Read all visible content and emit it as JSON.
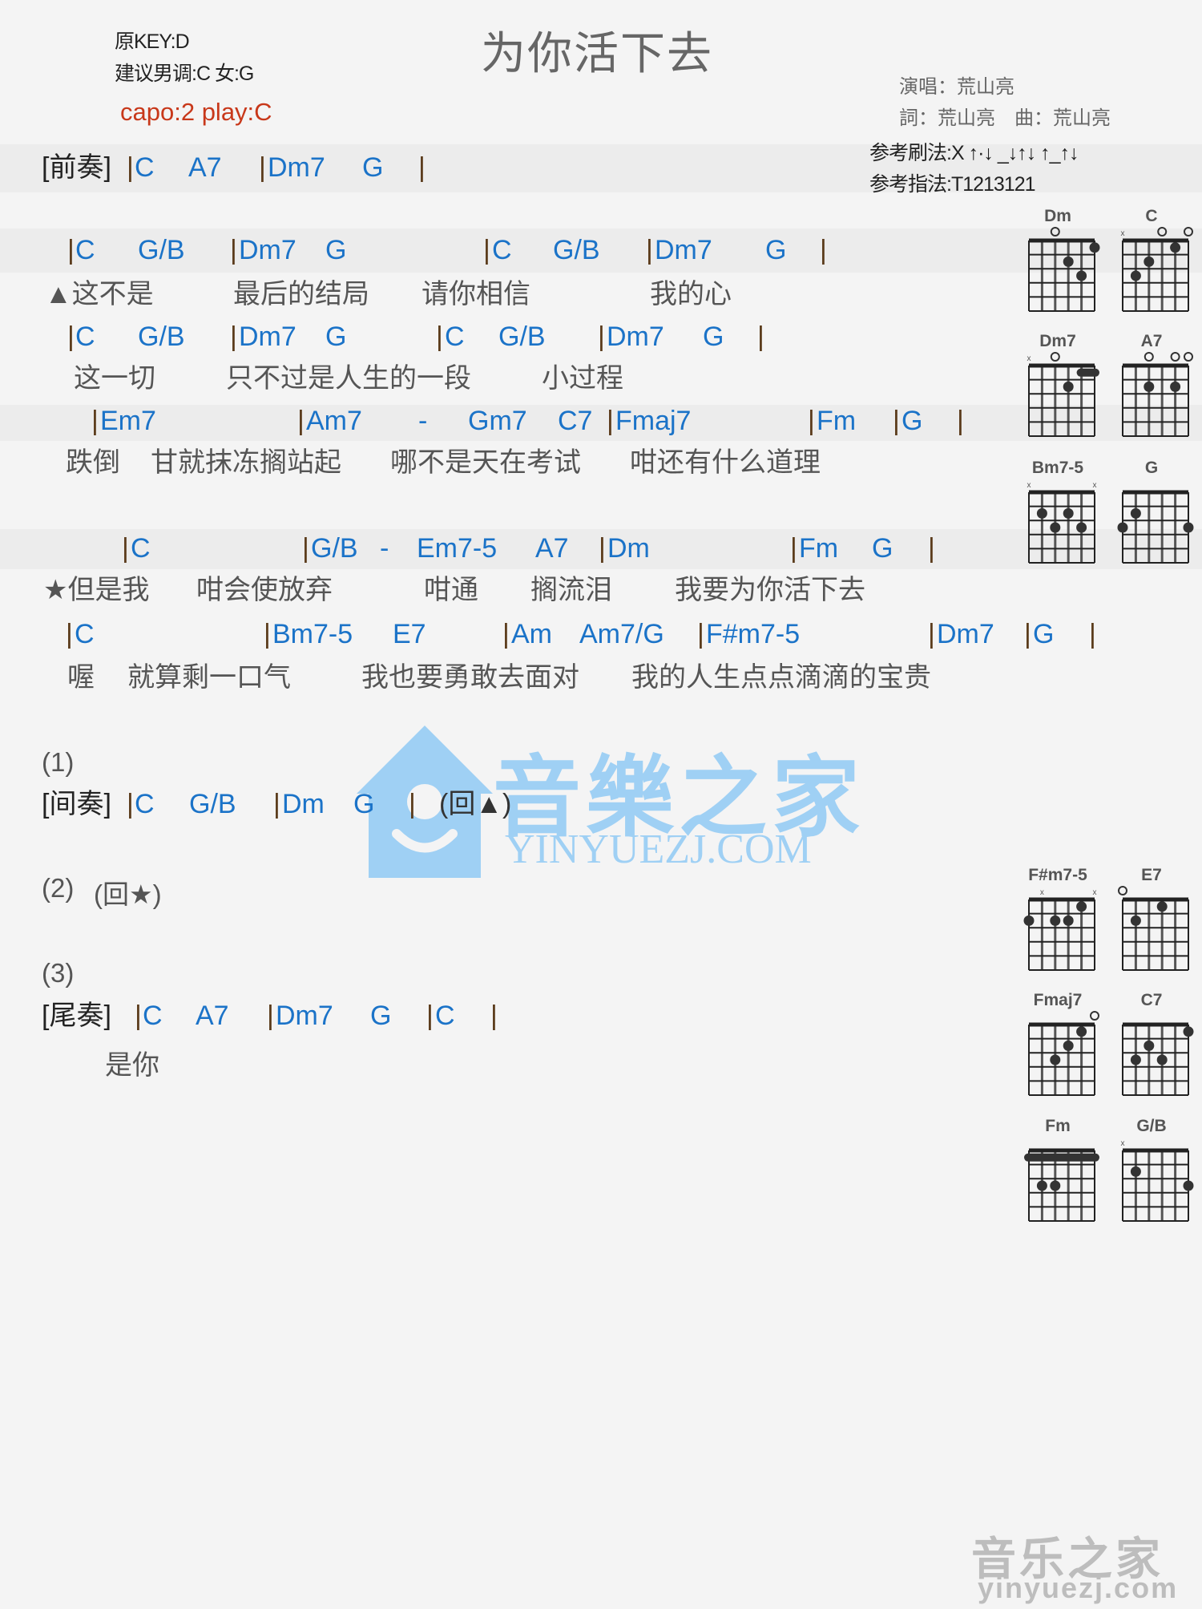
{
  "header": {
    "title": "为你活下去",
    "original_key": "原KEY:D",
    "suggested_key": "建议男调:C 女:G",
    "capo": "capo:2 play:C",
    "singer": "演唱：荒山亮",
    "writers": "詞：荒山亮　曲：荒山亮",
    "strum_pattern": "参考刷法:X ↑·↓ _↓↑↓ ↑_↑↓",
    "finger_pattern": "参考指法:T1213121"
  },
  "intro": {
    "label": "[前奏]",
    "tokens": [
      "|",
      "C",
      "A7",
      "|",
      "Dm7",
      "G",
      "|"
    ]
  },
  "verse": [
    {
      "chords": [
        "|",
        "C",
        "G/B",
        "|",
        "Dm7",
        "G",
        "|",
        "C",
        "G/B",
        "|",
        "Dm7",
        "G",
        "|"
      ],
      "lyrics": [
        "▲这不是",
        "最后的结局",
        "请你相信",
        "我的心"
      ]
    },
    {
      "chords": [
        "|",
        "C",
        "G/B",
        "|",
        "Dm7",
        "G",
        "|",
        "C",
        "G/B",
        "|",
        "Dm7",
        "G",
        "|"
      ],
      "lyrics": [
        "这一切",
        "只不过是人生的一段",
        "小过程"
      ]
    },
    {
      "chords": [
        "|",
        "Em7",
        "|",
        "Am7",
        "-",
        "Gm7",
        "C7",
        "|",
        "Fmaj7",
        "|",
        "Fm",
        "|",
        "G",
        "|"
      ],
      "lyrics": [
        "跌倒",
        "甘就抹冻搁站起",
        "哪不是天在考试",
        "咁还有什么道理"
      ]
    }
  ],
  "chorus": [
    {
      "chords": [
        "|",
        "C",
        "|",
        "G/B",
        "-",
        "Em7-5",
        "A7",
        "|",
        "Dm",
        "|",
        "Fm",
        "G",
        "|"
      ],
      "lyrics": [
        "★但是我",
        "咁会使放弃",
        "咁通",
        "搁流泪",
        "我要为你活下去"
      ]
    },
    {
      "chords": [
        "|",
        "C",
        "|",
        "Bm7-5",
        "E7",
        "|",
        "Am",
        "Am7/G",
        "|",
        "F#m7-5",
        "|",
        "Dm7",
        "|",
        "G",
        "|"
      ],
      "lyrics": [
        "喔",
        "就算剩一口气",
        "我也要勇敢去面对",
        "我的人生点点滴滴的宝贵"
      ]
    }
  ],
  "part1": {
    "marker": "(1)",
    "label": "[间奏]",
    "tokens": [
      "|",
      "C",
      "G/B",
      "|",
      "Dm",
      "G",
      "|"
    ],
    "repeat": "(回▲)"
  },
  "part2": {
    "marker": "(2)",
    "repeat": "(回★)"
  },
  "part3": {
    "marker": "(3)",
    "label": "[尾奏]",
    "tokens": [
      "|",
      "C",
      "A7",
      "|",
      "Dm7",
      "G",
      "|",
      "C",
      "|"
    ],
    "lyric": "是你"
  },
  "chord_diagrams": [
    {
      "name": "Dm",
      "open": [
        4
      ],
      "muted": [],
      "dots": [
        [
          1,
          1
        ],
        [
          3,
          2
        ],
        [
          2,
          3
        ]
      ],
      "barre": null
    },
    {
      "name": "C",
      "open": [
        3,
        1
      ],
      "muted": [
        6
      ],
      "dots": [
        [
          2,
          1
        ],
        [
          4,
          2
        ],
        [
          5,
          3
        ]
      ],
      "barre": null
    },
    {
      "name": "Dm7",
      "open": [
        4
      ],
      "muted": [
        6
      ],
      "dots": [
        [
          3,
          2
        ]
      ],
      "barre": {
        "fret": 1,
        "from": 2,
        "to": 1
      }
    },
    {
      "name": "A7",
      "open": [
        4,
        2,
        1
      ],
      "muted": [],
      "dots": [
        [
          4,
          2
        ],
        [
          2,
          2
        ]
      ],
      "barre": null
    },
    {
      "name": "Bm7-5",
      "open": [],
      "muted": [
        6,
        1
      ],
      "dots": [
        [
          5,
          2
        ],
        [
          3,
          2
        ],
        [
          4,
          3
        ],
        [
          2,
          3
        ]
      ],
      "barre": null
    },
    {
      "name": "G",
      "open": [],
      "muted": [],
      "dots": [
        [
          5,
          2
        ],
        [
          6,
          3
        ],
        [
          1,
          3
        ]
      ],
      "barre": null
    },
    {
      "name": "F#m7-5",
      "open": [],
      "muted": [
        5,
        1
      ],
      "dots": [
        [
          2,
          1
        ],
        [
          6,
          2
        ],
        [
          4,
          2
        ],
        [
          3,
          2
        ]
      ],
      "barre": null
    },
    {
      "name": "E7",
      "open": [
        6
      ],
      "muted": [],
      "dots": [
        [
          3,
          1
        ],
        [
          5,
          2
        ]
      ],
      "barre": null
    },
    {
      "name": "Fmaj7",
      "open": [
        1
      ],
      "muted": [],
      "dots": [
        [
          2,
          1
        ],
        [
          3,
          2
        ],
        [
          4,
          3
        ]
      ],
      "barre": null
    },
    {
      "name": "C7",
      "open": [],
      "muted": [],
      "dots": [
        [
          1,
          1
        ],
        [
          4,
          2
        ],
        [
          5,
          3
        ],
        [
          3,
          3
        ]
      ],
      "barre": null
    },
    {
      "name": "Fm",
      "open": [],
      "muted": [],
      "dots": [
        [
          5,
          3
        ],
        [
          4,
          3
        ]
      ],
      "barre": {
        "fret": 1,
        "from": 6,
        "to": 1
      }
    },
    {
      "name": "G/B",
      "open": [],
      "muted": [
        6
      ],
      "dots": [
        [
          5,
          2
        ],
        [
          1,
          3
        ]
      ],
      "barre": null
    }
  ],
  "watermark": {
    "center_cn": "音樂之家",
    "center_en": "YINYUEZJ.COM",
    "corner_cn": "音乐之家",
    "corner_en": "yinyuezj.com"
  },
  "colors": {
    "chord": "#1b73c8",
    "capo": "#c8381a",
    "title": "#666666",
    "watermark": "#9fd0f4"
  }
}
